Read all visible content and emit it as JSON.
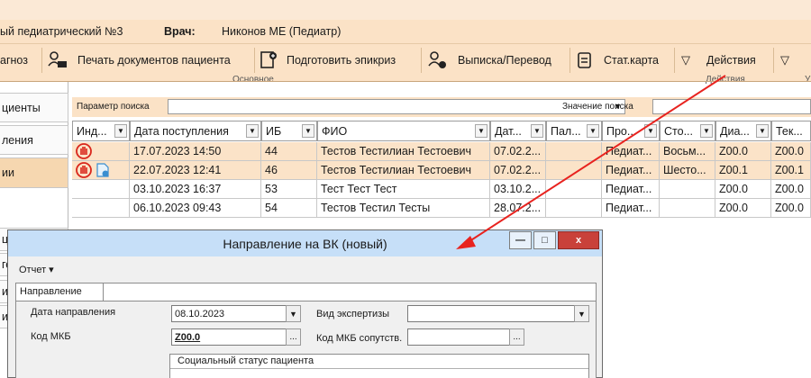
{
  "titlebar": {
    "clinic": "ый педиатрический №3",
    "doctor_label": "Врач:",
    "doctor_value": "Никонов МЕ (Педиатр)"
  },
  "toolbar": {
    "diagnosis_partial": "агноз",
    "print_docs": "Печать документов пациента",
    "prepare_epicrisis": "Подготовить эпикриз",
    "discharge": "Выписка/Перевод",
    "stat_card": "Стат.карта",
    "actions": "Действия",
    "group_main": "Основное",
    "group_actions": "Действия",
    "group_right_partial": "У"
  },
  "sidebar": {
    "items": [
      "циенты",
      "ления",
      "ии",
      "ц",
      "го",
      "ии",
      "ии"
    ]
  },
  "search": {
    "param_label": "Параметр поиска",
    "value_label": "Значение поиска"
  },
  "table": {
    "headers": [
      "Инд...",
      "Дата поступления",
      "ИБ",
      "ФИО",
      "Дат...",
      "Пал...",
      "Про...",
      "Сто...",
      "Диа...",
      "Тек..."
    ],
    "rows": [
      [
        "",
        "17.07.2023 14:50",
        "44",
        "Тестов Тестилиан Тестоевич",
        "07.02.2...",
        "",
        "Педиат...",
        "Восьм...",
        "Z00.0",
        "Z00.0"
      ],
      [
        "",
        "22.07.2023 12:41",
        "46",
        "Тестов Тестилиан Тестоевич",
        "07.02.2...",
        "",
        "Педиат...",
        "Шесто...",
        "Z00.1",
        "Z00.1"
      ],
      [
        "",
        "03.10.2023 16:37",
        "53",
        "Тест Тест Тест",
        "03.10.2...",
        "",
        "Педиат...",
        "",
        "Z00.0",
        "Z00.0"
      ],
      [
        "",
        "06.10.2023 09:43",
        "54",
        "Тестов Тестил Тесты",
        "28.07.2...",
        "",
        "Педиат...",
        "",
        "Z00.0",
        "Z00.0"
      ]
    ]
  },
  "dialog": {
    "title": "Направление на ВК (новый)",
    "menu_report": "Отчет ▾",
    "tab_direction": "Направление",
    "date_label": "Дата направления",
    "date_value": "08.10.2023",
    "exam_type_label": "Вид экспертизы",
    "mkb_label": "Код МКБ",
    "mkb_value": "Z00.0",
    "mkb_related_label": "Код МКБ сопутств.",
    "social_status_label": "Социальный статус пациента"
  },
  "colors": {
    "accent_orange": "#fbe2c6",
    "selected_row": "#fbe3c8",
    "dialog_title": "#c6dff8",
    "close_red": "#c9413a",
    "arrow_red": "#e8231f"
  }
}
